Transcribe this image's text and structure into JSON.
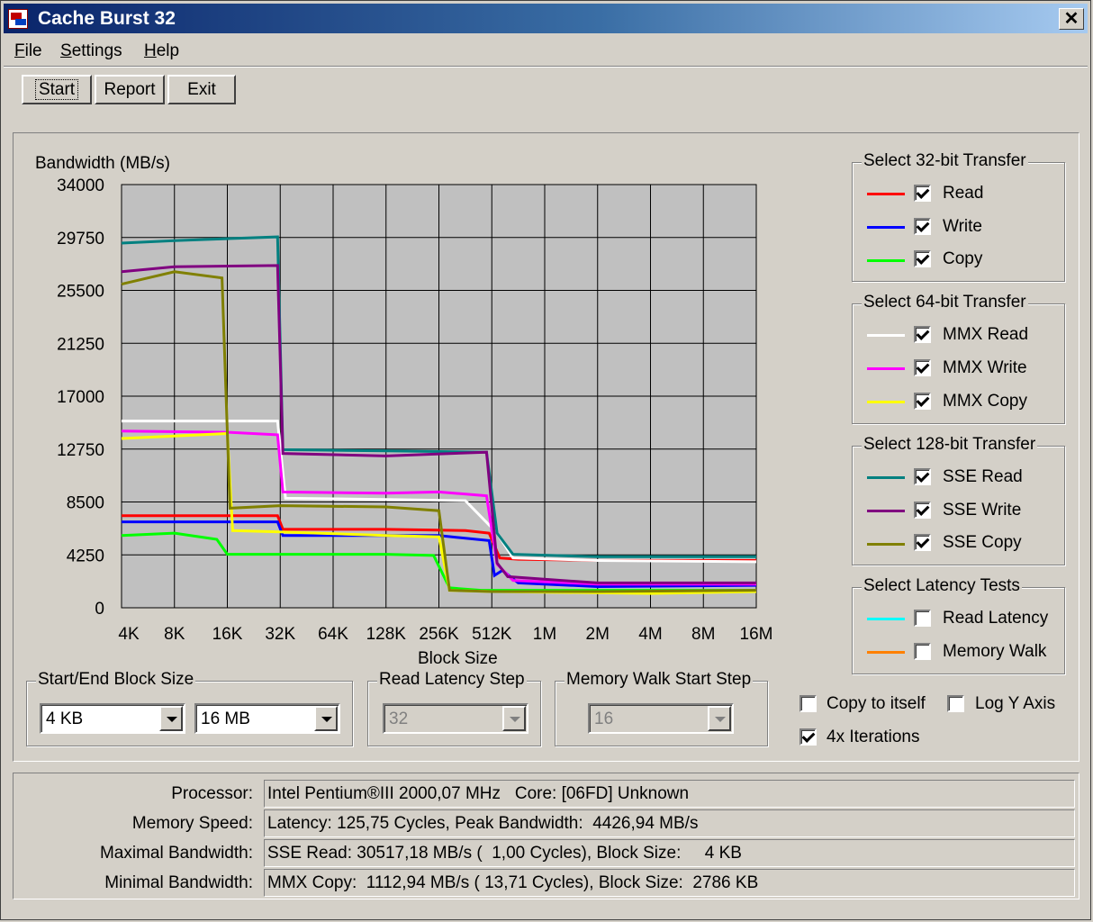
{
  "window": {
    "title": "Cache Burst 32",
    "close_glyph": "✕"
  },
  "menu": {
    "file": {
      "mnemonic": "F",
      "rest": "ile"
    },
    "settings": {
      "mnemonic": "S",
      "rest": "ettings"
    },
    "help": {
      "mnemonic": "H",
      "rest": "elp"
    }
  },
  "toolbar": {
    "start": "Start",
    "report": "Report",
    "exit": "Exit"
  },
  "legend": {
    "group32": {
      "title": "Select 32-bit Transfer",
      "items": [
        {
          "label": "Read",
          "color": "#ff0000",
          "checked": true
        },
        {
          "label": "Write",
          "color": "#0000ff",
          "checked": true
        },
        {
          "label": "Copy",
          "color": "#00ff00",
          "checked": true
        }
      ]
    },
    "group64": {
      "title": "Select 64-bit Transfer",
      "items": [
        {
          "label": "MMX Read",
          "color": "#ffffff",
          "checked": true
        },
        {
          "label": "MMX Write",
          "color": "#ff00ff",
          "checked": true
        },
        {
          "label": "MMX Copy",
          "color": "#ffff00",
          "checked": true
        }
      ]
    },
    "group128": {
      "title": "Select 128-bit Transfer",
      "items": [
        {
          "label": "SSE Read",
          "color": "#008080",
          "checked": true
        },
        {
          "label": "SSE Write",
          "color": "#800080",
          "checked": true
        },
        {
          "label": "SSE Copy",
          "color": "#808000",
          "checked": true
        }
      ]
    },
    "latency": {
      "title": "Select Latency Tests",
      "items": [
        {
          "label": "Read Latency",
          "color": "#00ffff",
          "checked": false
        },
        {
          "label": "Memory Walk",
          "color": "#ff8000",
          "checked": false
        }
      ]
    }
  },
  "options": {
    "copy_to_itself": {
      "label": "Copy to itself",
      "checked": false
    },
    "log_y_axis": {
      "label": "Log Y Axis",
      "checked": false
    },
    "iterations": {
      "label": "4x Iterations",
      "checked": true
    }
  },
  "block_size": {
    "title": "Start/End Block Size",
    "start": "4 KB",
    "end": "16 MB"
  },
  "read_latency_step": {
    "title": "Read Latency Step",
    "value": "32"
  },
  "memory_walk_step": {
    "title": "Memory Walk Start Step",
    "value": "16"
  },
  "info": {
    "processor": {
      "label": "Processor:",
      "value": "Intel Pentium®III 2000,07 MHz   Core: [06FD] Unknown"
    },
    "memory_speed": {
      "label": "Memory Speed:",
      "value": "Latency: 125,75 Cycles, Peak Bandwidth:  4426,94 MB/s"
    },
    "max_bw": {
      "label": "Maximal Bandwidth:",
      "value": "SSE Read: 30517,18 MB/s (  1,00 Cycles), Block Size:     4 KB"
    },
    "min_bw": {
      "label": "Minimal Bandwidth:",
      "value": "MMX Copy:  1112,94 MB/s ( 13,71 Cycles), Block Size:  2786 KB"
    }
  },
  "chart_data": {
    "type": "line",
    "ylabel": "Bandwidth (MB/s)",
    "xlabel": "Block Size",
    "ylim": [
      0,
      34000
    ],
    "yticks": [
      "34000",
      "29750",
      "25500",
      "21250",
      "17000",
      "12750",
      "8500",
      "4250",
      "0"
    ],
    "xticks": [
      "4K",
      "8K",
      "16K",
      "32K",
      "64K",
      "128K",
      "256K",
      "512K",
      "1M",
      "2M",
      "4M",
      "8M",
      "16M"
    ],
    "grid": true,
    "x_unit": "log2 step index (0 = 4K, 12 = 16M)",
    "series": [
      {
        "name": "Read",
        "color": "#ff0000",
        "points": [
          [
            0,
            7400
          ],
          [
            2.95,
            7400
          ],
          [
            3.05,
            6300
          ],
          [
            5,
            6300
          ],
          [
            6.5,
            6200
          ],
          [
            6.95,
            6000
          ],
          [
            7.15,
            4000
          ],
          [
            7.5,
            3900
          ],
          [
            9,
            3800
          ],
          [
            10,
            3800
          ],
          [
            12,
            3800
          ]
        ]
      },
      {
        "name": "Write",
        "color": "#0000ff",
        "points": [
          [
            0,
            6900
          ],
          [
            2.95,
            6900
          ],
          [
            3.05,
            5800
          ],
          [
            6,
            5800
          ],
          [
            6.95,
            5400
          ],
          [
            7.05,
            2600
          ],
          [
            7.2,
            3000
          ],
          [
            7.5,
            2000
          ],
          [
            9,
            1700
          ],
          [
            12,
            1800
          ]
        ]
      },
      {
        "name": "Copy",
        "color": "#00ff00",
        "points": [
          [
            0,
            5800
          ],
          [
            1,
            6000
          ],
          [
            1.8,
            5500
          ],
          [
            2,
            4300
          ],
          [
            3,
            4300
          ],
          [
            5,
            4300
          ],
          [
            5.9,
            4200
          ],
          [
            6.2,
            1600
          ],
          [
            6.8,
            1400
          ],
          [
            9,
            1400
          ],
          [
            12,
            1400
          ]
        ]
      },
      {
        "name": "MMX Read",
        "color": "#ffffff",
        "points": [
          [
            0,
            15000
          ],
          [
            2.95,
            15000
          ],
          [
            3.1,
            8800
          ],
          [
            5,
            8700
          ],
          [
            6.5,
            8600
          ],
          [
            7.1,
            6000
          ],
          [
            7.4,
            4000
          ],
          [
            9,
            3800
          ],
          [
            12,
            3700
          ]
        ]
      },
      {
        "name": "MMX Write",
        "color": "#ff00ff",
        "points": [
          [
            0,
            14200
          ],
          [
            2,
            14100
          ],
          [
            2.95,
            13900
          ],
          [
            3.05,
            9300
          ],
          [
            5,
            9200
          ],
          [
            6,
            9300
          ],
          [
            6.9,
            9000
          ],
          [
            7.1,
            3500
          ],
          [
            7.4,
            2200
          ],
          [
            9,
            1900
          ],
          [
            12,
            1900
          ]
        ]
      },
      {
        "name": "MMX Copy",
        "color": "#ffff00",
        "points": [
          [
            0,
            13600
          ],
          [
            2,
            14000
          ],
          [
            2.1,
            6200
          ],
          [
            3,
            6100
          ],
          [
            5,
            5800
          ],
          [
            6,
            5700
          ],
          [
            6.2,
            1400
          ],
          [
            7,
            1300
          ],
          [
            9,
            1200
          ],
          [
            10,
            1150
          ],
          [
            12,
            1300
          ]
        ]
      },
      {
        "name": "SSE Read",
        "color": "#008080",
        "points": [
          [
            0,
            29300
          ],
          [
            1,
            29500
          ],
          [
            2.95,
            29800
          ],
          [
            3.05,
            12700
          ],
          [
            5,
            12600
          ],
          [
            6.9,
            12500
          ],
          [
            7.1,
            6000
          ],
          [
            7.4,
            4300
          ],
          [
            9,
            4100
          ],
          [
            12,
            4100
          ]
        ]
      },
      {
        "name": "SSE Write",
        "color": "#800080",
        "points": [
          [
            0,
            27000
          ],
          [
            1,
            27400
          ],
          [
            2.95,
            27500
          ],
          [
            3.05,
            12400
          ],
          [
            5,
            12200
          ],
          [
            6.9,
            12500
          ],
          [
            7.1,
            3600
          ],
          [
            7.3,
            2500
          ],
          [
            9,
            2000
          ],
          [
            12,
            2000
          ]
        ]
      },
      {
        "name": "SSE Copy",
        "color": "#808000",
        "points": [
          [
            0,
            26000
          ],
          [
            1,
            27000
          ],
          [
            1.9,
            26500
          ],
          [
            2.05,
            8000
          ],
          [
            3,
            8200
          ],
          [
            5,
            8100
          ],
          [
            6,
            7800
          ],
          [
            6.2,
            1400
          ],
          [
            7,
            1300
          ],
          [
            9,
            1300
          ],
          [
            12,
            1400
          ]
        ]
      }
    ]
  }
}
